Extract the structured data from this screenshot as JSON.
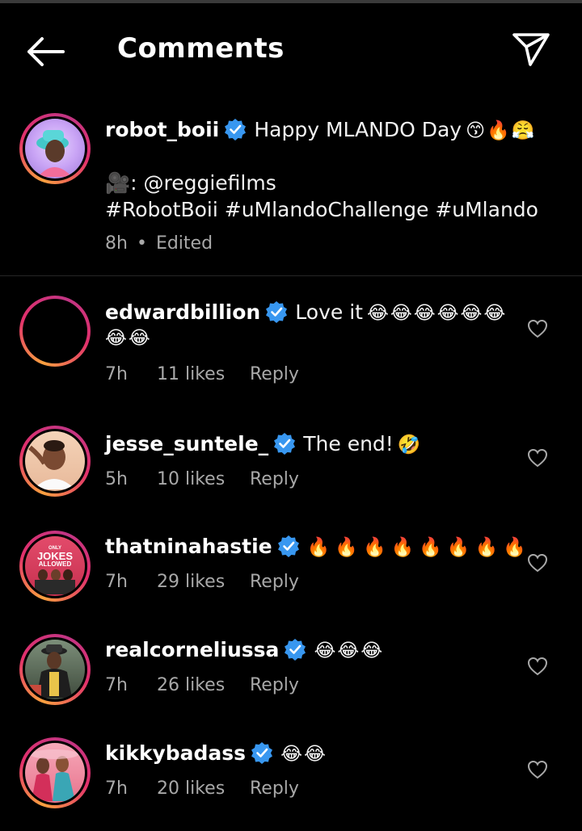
{
  "header": {
    "title": "Comments",
    "back_icon": "back-arrow-icon",
    "share_icon": "paper-plane-icon"
  },
  "caption": {
    "username": "robot_boii",
    "text": "Happy MLANDO Day",
    "emojis": "😙🔥😤",
    "credit_icon": "🎥",
    "credit": ": @reggiefilms",
    "hashtags": "#RobotBoii #uMlandoChallenge #uMlando",
    "time": "8h",
    "separator": "•",
    "edited": "Edited"
  },
  "comments": [
    {
      "username": "edwardbillion",
      "text": "Love it",
      "emojis_line1": "😂😂😂😂😂😂",
      "emojis_line2": "😂😂",
      "time": "7h",
      "likes": "11 likes",
      "reply": "Reply"
    },
    {
      "username": "jesse_suntele_",
      "text": "The end!",
      "emojis": "🤣",
      "time": "5h",
      "likes": "10 likes",
      "reply": "Reply"
    },
    {
      "username": "thatninahastie",
      "text": "",
      "emojis": "🔥🔥🔥🔥🔥🔥🔥🔥",
      "time": "7h",
      "likes": "29 likes",
      "reply": "Reply",
      "avatar_text_1": "ONLY",
      "avatar_text_2": "JOKES",
      "avatar_text_3": "ALLOWED"
    },
    {
      "username": "realcorneliussa",
      "text": "",
      "emojis": "😂😂😂",
      "time": "7h",
      "likes": "26 likes",
      "reply": "Reply"
    },
    {
      "username": "kikkybadass",
      "text": "",
      "emojis": "😂😂",
      "time": "7h",
      "likes": "20 likes",
      "reply": "Reply"
    }
  ],
  "colors": {
    "background": "#000000",
    "verified": "#3897f0",
    "meta_text": "#a8a8a8",
    "ring_start": "#f9a03f",
    "ring_end": "#c13584"
  }
}
